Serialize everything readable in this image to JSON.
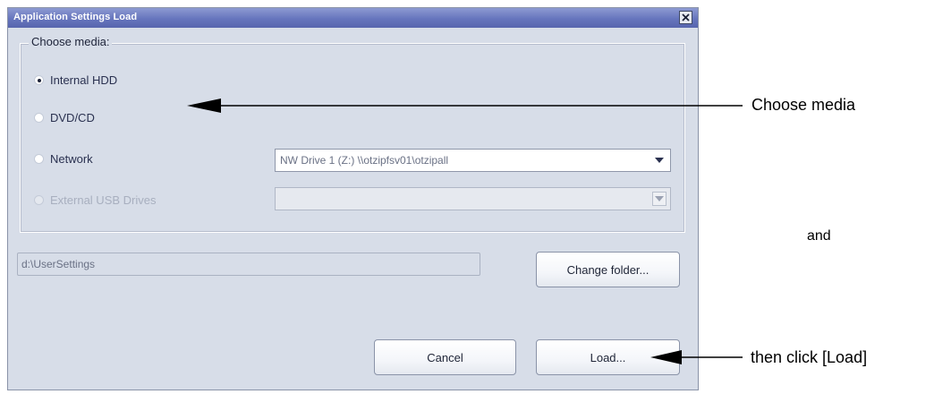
{
  "dialog": {
    "title": "Application Settings Load",
    "close_icon": "close-icon"
  },
  "media": {
    "legend": "Choose media:",
    "options": [
      {
        "label": "Internal HDD",
        "selected": true,
        "enabled": true
      },
      {
        "label": "DVD/CD",
        "selected": false,
        "enabled": true
      },
      {
        "label": "Network",
        "selected": false,
        "enabled": true
      },
      {
        "label": "External USB Drives",
        "selected": false,
        "enabled": false
      }
    ],
    "network_drive": "NW Drive 1 (Z:) \\\\otzipfsv01\\otzipall",
    "usb_drive": ""
  },
  "folder": {
    "path": "d:\\UserSettings",
    "change_label": "Change folder..."
  },
  "buttons": {
    "cancel": "Cancel",
    "load": "Load..."
  },
  "annotations": {
    "choose_media": "Choose media",
    "and": "and",
    "then_click": "then click [Load]"
  },
  "colors": {
    "titlebar": "#6675bd",
    "dialog_bg": "#d7dde8"
  }
}
